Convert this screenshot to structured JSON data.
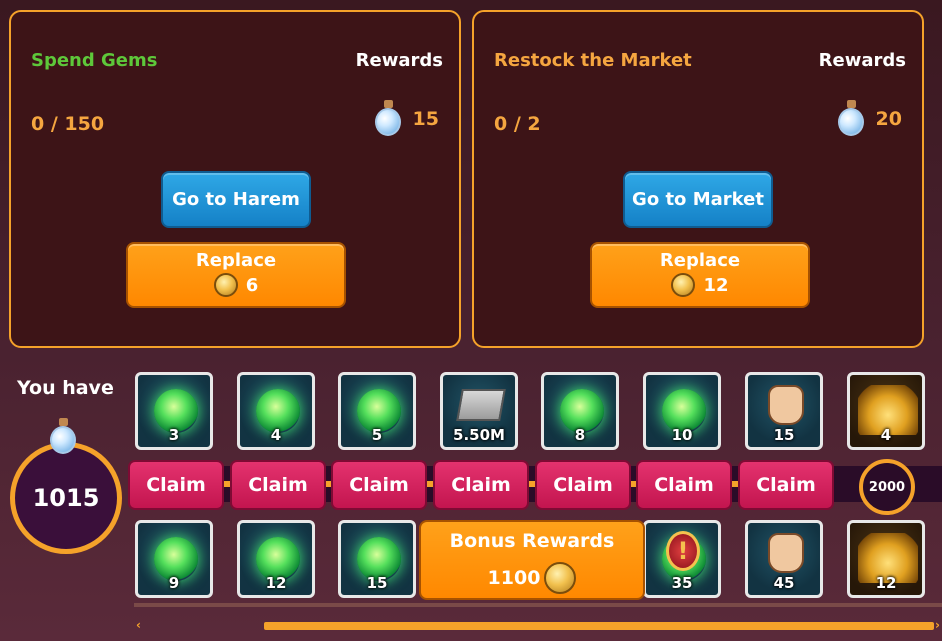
{
  "tasks": [
    {
      "title": "Spend Gems",
      "rewards_label": "Rewards",
      "progress": "0 / 150",
      "reward_amount": "15",
      "action_label": "Go to Harem",
      "replace_label": "Replace",
      "replace_cost": "6"
    },
    {
      "title": "Restock the Market",
      "rewards_label": "Rewards",
      "progress": "0 / 2",
      "reward_amount": "20",
      "action_label": "Go to Market",
      "replace_label": "Replace",
      "replace_cost": "12"
    }
  ],
  "you_have": {
    "label": "You have",
    "value": "1015"
  },
  "top_rewards": [
    {
      "icon": "green-orb-icon",
      "num": "3"
    },
    {
      "icon": "green-orb-icon",
      "num": "4"
    },
    {
      "icon": "green-orb-icon",
      "num": "5"
    },
    {
      "icon": "money-stack-icon",
      "num": "5.50M"
    },
    {
      "icon": "green-orb-icon",
      "num": "8"
    },
    {
      "icon": "green-orb-icon",
      "num": "10"
    },
    {
      "icon": "fist-icon",
      "num": "15"
    },
    {
      "icon": "gold-pile-icon",
      "num": "4"
    }
  ],
  "bottom_rewards": [
    {
      "icon": "green-orb-icon",
      "num": "9"
    },
    {
      "icon": "green-orb-icon",
      "num": "12"
    },
    {
      "icon": "green-orb-icon",
      "num": "15"
    },
    {
      "icon": "green-orb-icon",
      "num": "35"
    },
    {
      "icon": "fist-icon",
      "num": "45"
    },
    {
      "icon": "gold-pile-icon",
      "num": "12"
    }
  ],
  "claim_label": "Claim",
  "next_goal": "2000",
  "bonus": {
    "title": "Bonus Rewards",
    "cost": "1100"
  },
  "colors": {
    "accent": "#f5a22a",
    "claim": "#c3154f",
    "blue": "#1581c7"
  }
}
